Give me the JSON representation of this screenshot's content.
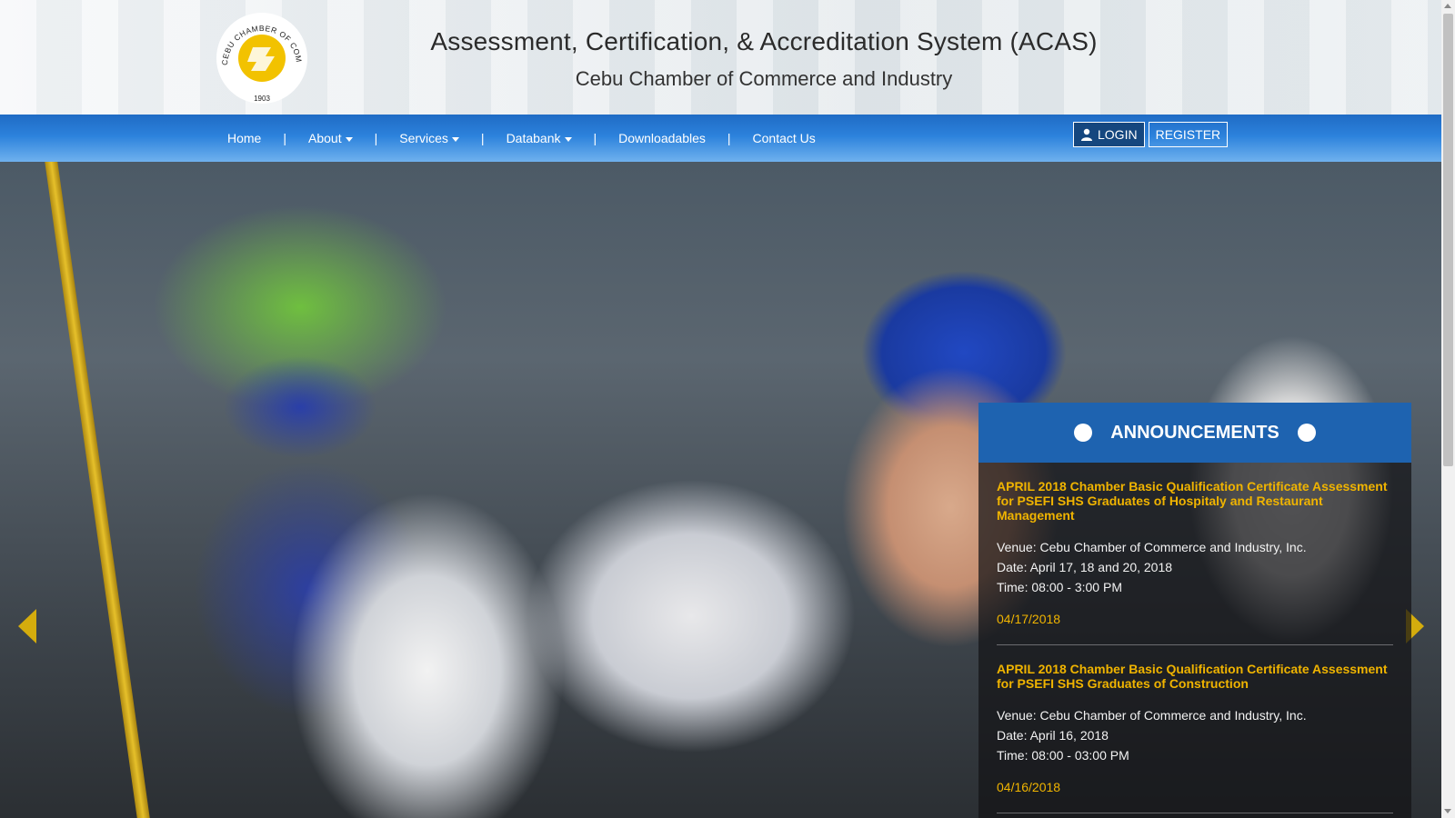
{
  "header": {
    "logo": {
      "icon": "chamber-seal-logo",
      "ring_text": "CEBU CHAMBER OF COMMERCE & INDUSTRY",
      "year": "1903",
      "color": "#f2c200"
    },
    "title": "Assessment, Certification, & Accreditation System (ACAS)",
    "subtitle": "Cebu Chamber of Commerce and Industry"
  },
  "nav": {
    "items": [
      {
        "label": "Home"
      },
      {
        "label": "About",
        "dropdown": true
      },
      {
        "label": "Services",
        "dropdown": true
      },
      {
        "label": "Databank",
        "dropdown": true
      },
      {
        "label": "Downloadables"
      },
      {
        "label": "Contact Us"
      }
    ],
    "separator": "|",
    "login_label": "LOGIN",
    "register_label": "REGISTER",
    "colors": {
      "bar_top": "#1f6bc4",
      "bar_bottom": "#6fb1ee"
    }
  },
  "hero": {
    "prev_icon": "chevron-left-icon",
    "next_icon": "chevron-right-icon",
    "arrow_color": "#d4ac0d"
  },
  "announcements": {
    "title": "ANNOUNCEMENTS",
    "header_color": "#1e63b0",
    "accent_color": "#f0b400",
    "items": [
      {
        "title": "APRIL 2018 Chamber Basic Qualification Certificate Assessment for PSEFI SHS Graduates of Hospitaly and Restaurant Management",
        "venue": "Venue: Cebu Chamber of Commerce and Industry, Inc.",
        "date_line": "Date: April 17, 18 and 20, 2018",
        "time_line": "Time: 08:00 - 3:00 PM",
        "posted": "04/17/2018"
      },
      {
        "title": "APRIL 2018 Chamber Basic Qualification Certificate Assessment for PSEFI SHS Graduates of Construction",
        "venue": "Venue: Cebu Chamber of Commerce and Industry, Inc.",
        "date_line": "Date: April 16, 2018",
        "time_line": "Time: 08:00 - 03:00 PM",
        "posted": "04/16/2018"
      }
    ]
  }
}
